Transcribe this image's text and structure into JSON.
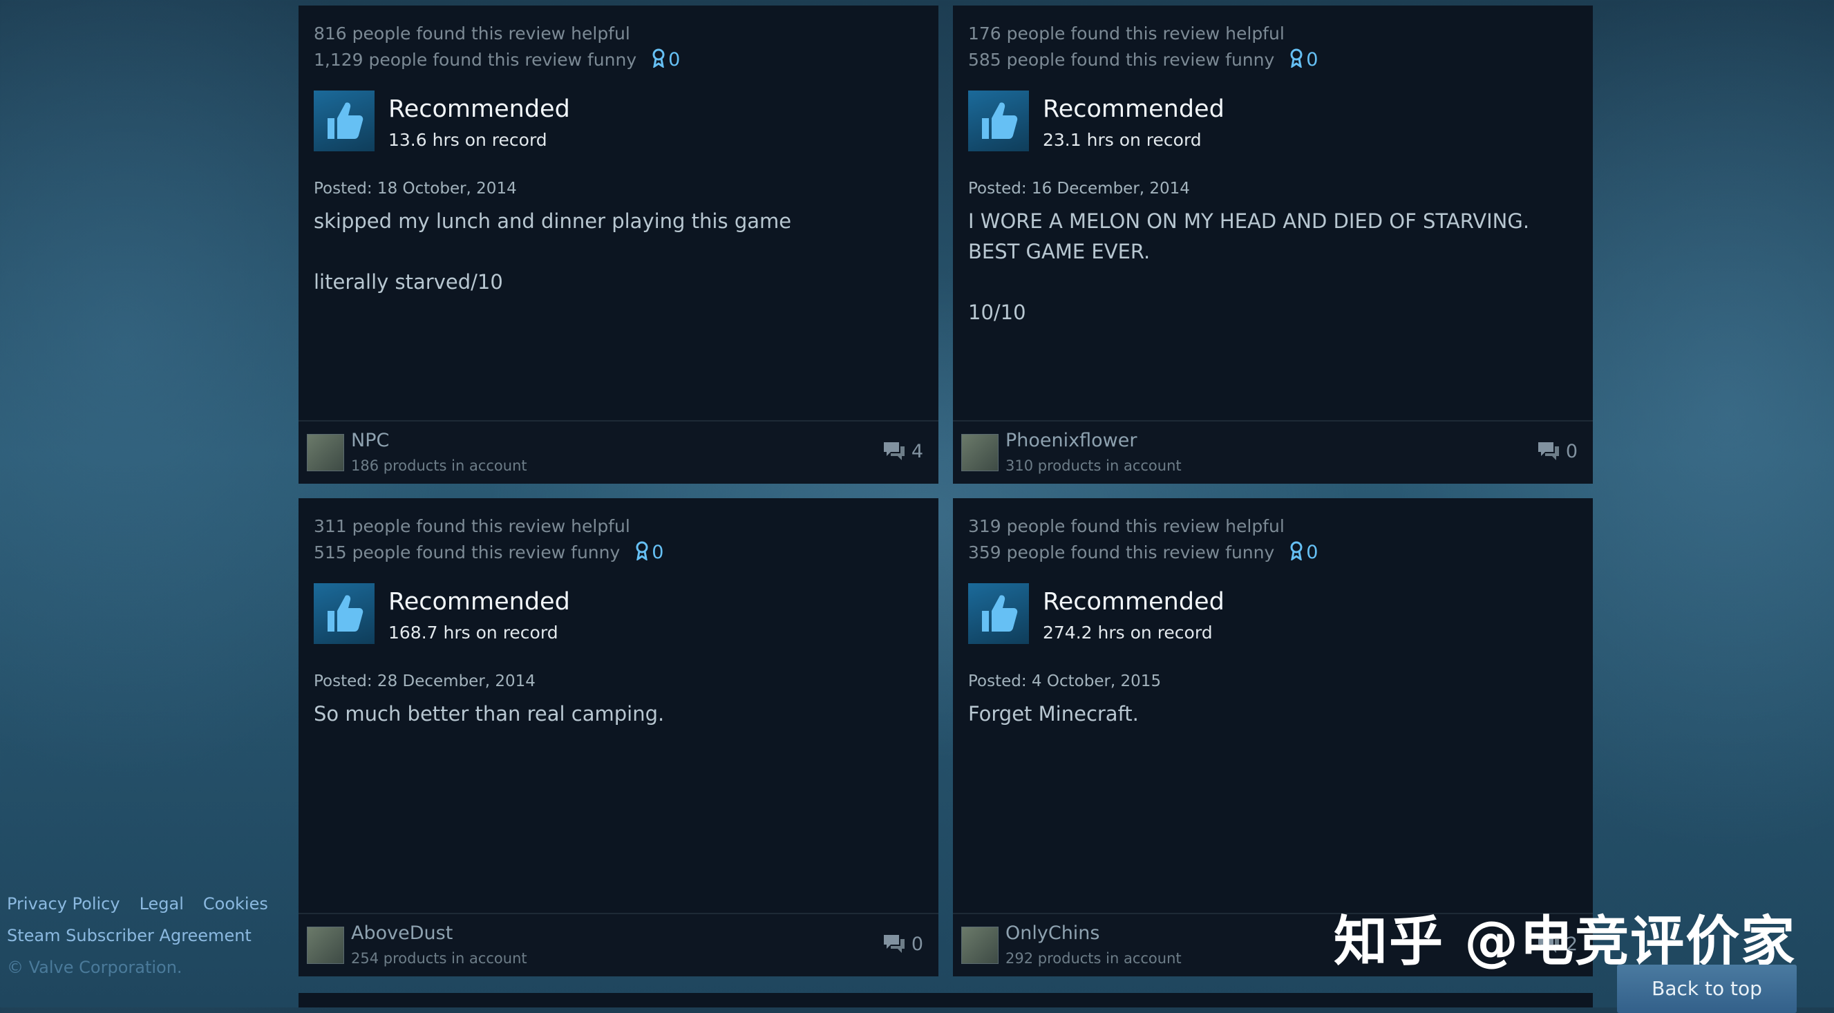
{
  "reviews": [
    {
      "helpful": "816 people found this review helpful",
      "funny": "1,129 people found this review funny",
      "awards": "0",
      "verdict": "Recommended",
      "hours": "13.6 hrs on record",
      "posted": "Posted: 18 October, 2014",
      "body": "skipped my lunch and dinner playing this game\n\nliterally starved/10",
      "user": "NPC",
      "products": "186 products in account",
      "comments": "4"
    },
    {
      "helpful": "176 people found this review helpful",
      "funny": "585 people found this review funny",
      "awards": "0",
      "verdict": "Recommended",
      "hours": "23.1 hrs on record",
      "posted": "Posted: 16 December, 2014",
      "body": "I WORE A MELON ON MY HEAD AND DIED OF STARVING. BEST GAME EVER.\n\n10/10",
      "user": "Phoenixflower",
      "products": "310 products in account",
      "comments": "0"
    },
    {
      "helpful": "311 people found this review helpful",
      "funny": "515 people found this review funny",
      "awards": "0",
      "verdict": "Recommended",
      "hours": "168.7 hrs on record",
      "posted": "Posted: 28 December, 2014",
      "body": "So much better than real camping.",
      "user": "AboveDust",
      "products": "254 products in account",
      "comments": "0"
    },
    {
      "helpful": "319 people found this review helpful",
      "funny": "359 people found this review funny",
      "awards": "0",
      "verdict": "Recommended",
      "hours": "274.2 hrs on record",
      "posted": "Posted: 4 October, 2015",
      "body": "Forget Minecraft.",
      "user": "OnlyChins",
      "products": "292 products in account",
      "comments": "2"
    }
  ],
  "footer": {
    "privacy": "Privacy Policy",
    "legal": "Legal",
    "cookies": "Cookies",
    "ssa": "Steam Subscriber Agreement",
    "copyright": "© Valve Corporation."
  },
  "back_to_top": "Back to top",
  "watermark": "知乎 @电竞评价家",
  "icons": {
    "award": "award-icon",
    "thumb": "thumbs-up-icon",
    "comment": "comment-icon"
  },
  "colors": {
    "accent": "#66c0f4",
    "card_bg": "#0c1521"
  }
}
